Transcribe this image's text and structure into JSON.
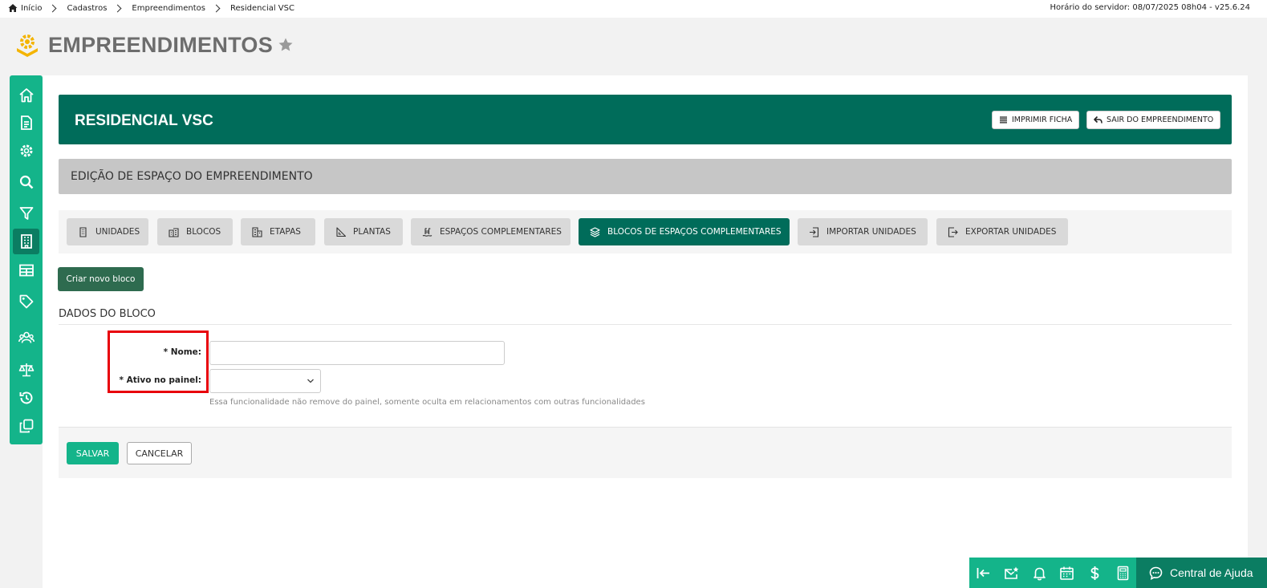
{
  "breadcrumb": {
    "items": [
      "Início",
      "Cadastros",
      "Empreendimentos",
      "Residencial VSC"
    ]
  },
  "server_time": "Horário do servidor: 08/07/2025 08h04 - v25.6.24",
  "page": {
    "title": "EMPREENDIMENTOS"
  },
  "sidebar": {
    "icons": [
      "home-icon",
      "document-icon",
      "gear-icon",
      "search-icon",
      "filter-icon",
      "building-icon",
      "table-icon",
      "tag-icon",
      "users-icon",
      "scale-icon",
      "history-icon",
      "copy-icon"
    ],
    "active": "building-icon"
  },
  "banner": {
    "title": "RESIDENCIAL VSC",
    "print_label": "IMPRIMIR FICHA",
    "exit_label": "SAIR DO EMPREENDIMENTO"
  },
  "subheader": "EDIÇÃO DE ESPAÇO DO EMPREENDIMENTO",
  "tabs": [
    {
      "label": "UNIDADES",
      "icon": "building-icon"
    },
    {
      "label": "BLOCOS",
      "icon": "blocks-icon"
    },
    {
      "label": "ETAPAS",
      "icon": "stages-icon"
    },
    {
      "label": "PLANTAS",
      "icon": "ruler-icon"
    },
    {
      "label": "ESPAÇOS COMPLEMENTARES",
      "icon": "pool-icon"
    },
    {
      "label": "BLOCOS DE ESPAÇOS COMPLEMENTARES",
      "icon": "layers-icon",
      "active": true
    },
    {
      "label": "IMPORTAR UNIDADES",
      "icon": "import-icon"
    },
    {
      "label": "EXPORTAR UNIDADES",
      "icon": "export-icon"
    }
  ],
  "new_block_label": "Criar novo bloco",
  "section_title": "DADOS DO BLOCO",
  "form": {
    "name_label": "* Nome:",
    "name_value": "",
    "active_label": "* Ativo no painel:",
    "active_value": "",
    "hint": "Essa funcionalidade não remove do painel, somente oculta em relacionamentos com outras funcionalidades"
  },
  "actions": {
    "save_label": "SALVAR",
    "cancel_label": "CANCELAR"
  },
  "dock": {
    "icons": [
      "collapse-left-icon",
      "mail-star-icon",
      "bell-icon",
      "calendar-icon",
      "dollar-icon",
      "calculator-icon"
    ],
    "help_label": "Central de Ajuda"
  },
  "colors": {
    "primary_dark": "#006c5a",
    "primary": "#14b48a",
    "highlight": "#e8000a"
  }
}
